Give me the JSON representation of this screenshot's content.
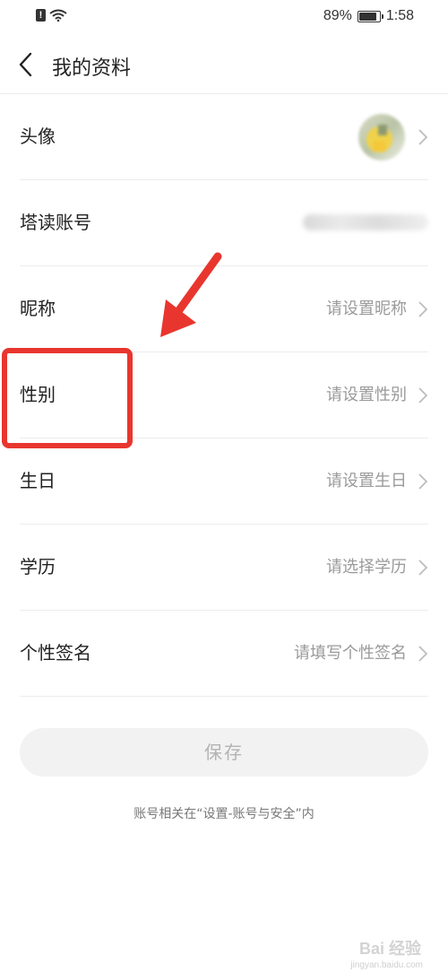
{
  "status_bar": {
    "battery_text": "89%",
    "battery_level": 0.89,
    "time": "1:58",
    "icons": [
      "alert-icon",
      "wifi-icon",
      "battery-icon"
    ]
  },
  "header": {
    "title": "我的资料",
    "back_icon": "chevron-left-icon"
  },
  "profile_rows": [
    {
      "label": "头像",
      "value": "",
      "type": "avatar"
    },
    {
      "label": "塔读账号",
      "value": "",
      "type": "account"
    },
    {
      "label": "昵称",
      "value": "请设置昵称",
      "type": "setting"
    },
    {
      "label": "性别",
      "value": "请设置性别",
      "type": "setting"
    },
    {
      "label": "生日",
      "value": "请设置生日",
      "type": "setting"
    },
    {
      "label": "学历",
      "value": "请选择学历",
      "type": "setting"
    },
    {
      "label": "个性签名",
      "value": "请填写个性签名",
      "type": "setting"
    }
  ],
  "save_button": {
    "label": "保存"
  },
  "footer_note": "账号相关在“设置-账号与安全”内",
  "annotation": {
    "highlight_color": "#e8362e"
  },
  "watermark": {
    "text": "Bai 经验",
    "sub": "jingyan.baidu.com"
  }
}
